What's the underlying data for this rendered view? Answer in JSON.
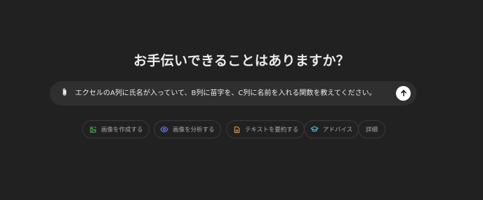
{
  "heading": "お手伝いできることはありますか？",
  "composer": {
    "prompt_text": "エクセルのA列に氏名が入っていて、B列に苗字を、C列に名前を入れる関数を教えてください。",
    "attach_icon": "paperclip-icon",
    "send_icon": "arrow-up-icon"
  },
  "chips": [
    {
      "label": "画像を作成する",
      "icon": "image-create-icon",
      "color": "#4caf50"
    },
    {
      "label": "画像を分析する",
      "icon": "eye-icon",
      "color": "#6f7bf7"
    },
    {
      "label": "テキストを要約する",
      "icon": "document-icon",
      "color": "#e8a35c"
    },
    {
      "label": "アドバイス",
      "icon": "graduation-cap-icon",
      "color": "#5ab4e5"
    },
    {
      "label": "詳細",
      "icon": "",
      "color": ""
    }
  ],
  "colors": {
    "background": "#212121",
    "composer": "#2f2f2f",
    "text": "#ececec",
    "chip_text": "#a8a8a8",
    "chip_border": "#3a3a3a"
  }
}
